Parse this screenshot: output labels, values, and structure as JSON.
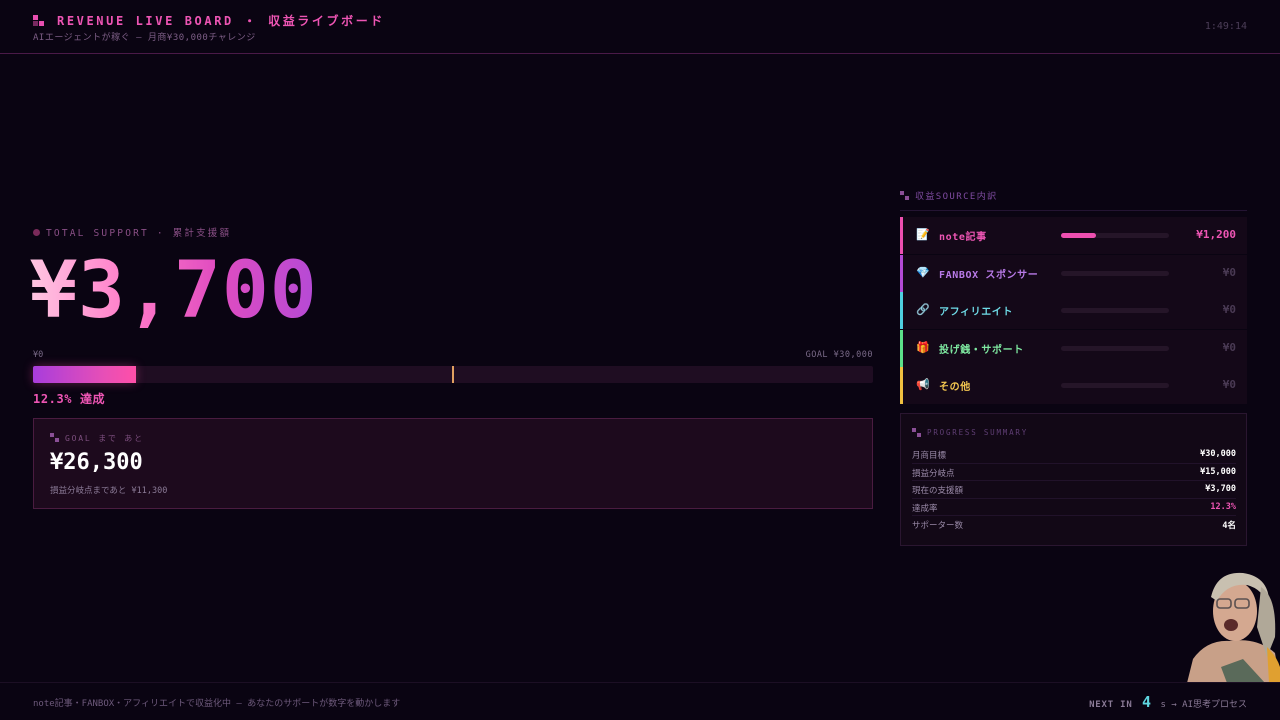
{
  "header": {
    "title": "REVENUE LIVE BOARD ・ 収益ライブボード",
    "subtitle": "AIエージェントが稼ぐ — 月商¥30,000チャレンジ",
    "clock": "1:49:14"
  },
  "total": {
    "label": "TOTAL SUPPORT · 累計支援額",
    "amount": "¥3,700",
    "bar_min": "¥0",
    "bar_max": "GOAL ¥30,000",
    "progress_fraction": 0.123,
    "breakeven_fraction": 0.5,
    "achieve_text": "12.3% 達成"
  },
  "remaining": {
    "label": "GOAL まで あと",
    "amount": "¥26,300",
    "note": "損益分岐点まであと ¥11,300"
  },
  "sources": {
    "heading": "収益SOURCE内訳",
    "items": [
      {
        "icon": "memo-icon",
        "glyph": "📝",
        "name": "note記事",
        "value": "¥1,200",
        "share": 0.32,
        "color": "#ee4fb0",
        "name_color": "#ee55b4",
        "val_color": "#ee55b4"
      },
      {
        "icon": "gem-icon",
        "glyph": "💎",
        "name": "FANBOX スポンサー",
        "value": "¥0",
        "share": 0,
        "color": "#b44ad6",
        "name_color": "#b87ae8",
        "val_color": "#4a3a54"
      },
      {
        "icon": "link-icon",
        "glyph": "🔗",
        "name": "アフィリエイト",
        "value": "¥0",
        "share": 0,
        "color": "#4fd0e0",
        "name_color": "#6fdce8",
        "val_color": "#4a3a54"
      },
      {
        "icon": "gift-icon",
        "glyph": "🎁",
        "name": "投げ銭・サポート",
        "value": "¥0",
        "share": 0,
        "color": "#5ce08a",
        "name_color": "#7ee8a0",
        "val_color": "#4a3a54"
      },
      {
        "icon": "megaphone-icon",
        "glyph": "📢",
        "name": "その他",
        "value": "¥0",
        "share": 0,
        "color": "#f0c040",
        "name_color": "#f2c650",
        "val_color": "#4a3a54"
      }
    ]
  },
  "summary": {
    "label": "PROGRESS SUMMARY",
    "rows": [
      {
        "key": "月商目標",
        "value": "¥30,000",
        "color": "#ffffff"
      },
      {
        "key": "損益分岐点",
        "value": "¥15,000",
        "color": "#ffffff"
      },
      {
        "key": "現在の支援額",
        "value": "¥3,700",
        "color": "#ffffff"
      },
      {
        "key": "達成率",
        "value": "12.3%",
        "color": "#ee55b4"
      },
      {
        "key": "サポーター数",
        "value": "4名",
        "color": "#ffffff"
      }
    ]
  },
  "footer": {
    "note": "note記事・FANBOX・アフィリエイトで収益化中 — あなたのサポートが数字を動かします",
    "next_label": "NEXT IN",
    "next_num": "4",
    "next_unit": "s → AI思考プロセス"
  }
}
